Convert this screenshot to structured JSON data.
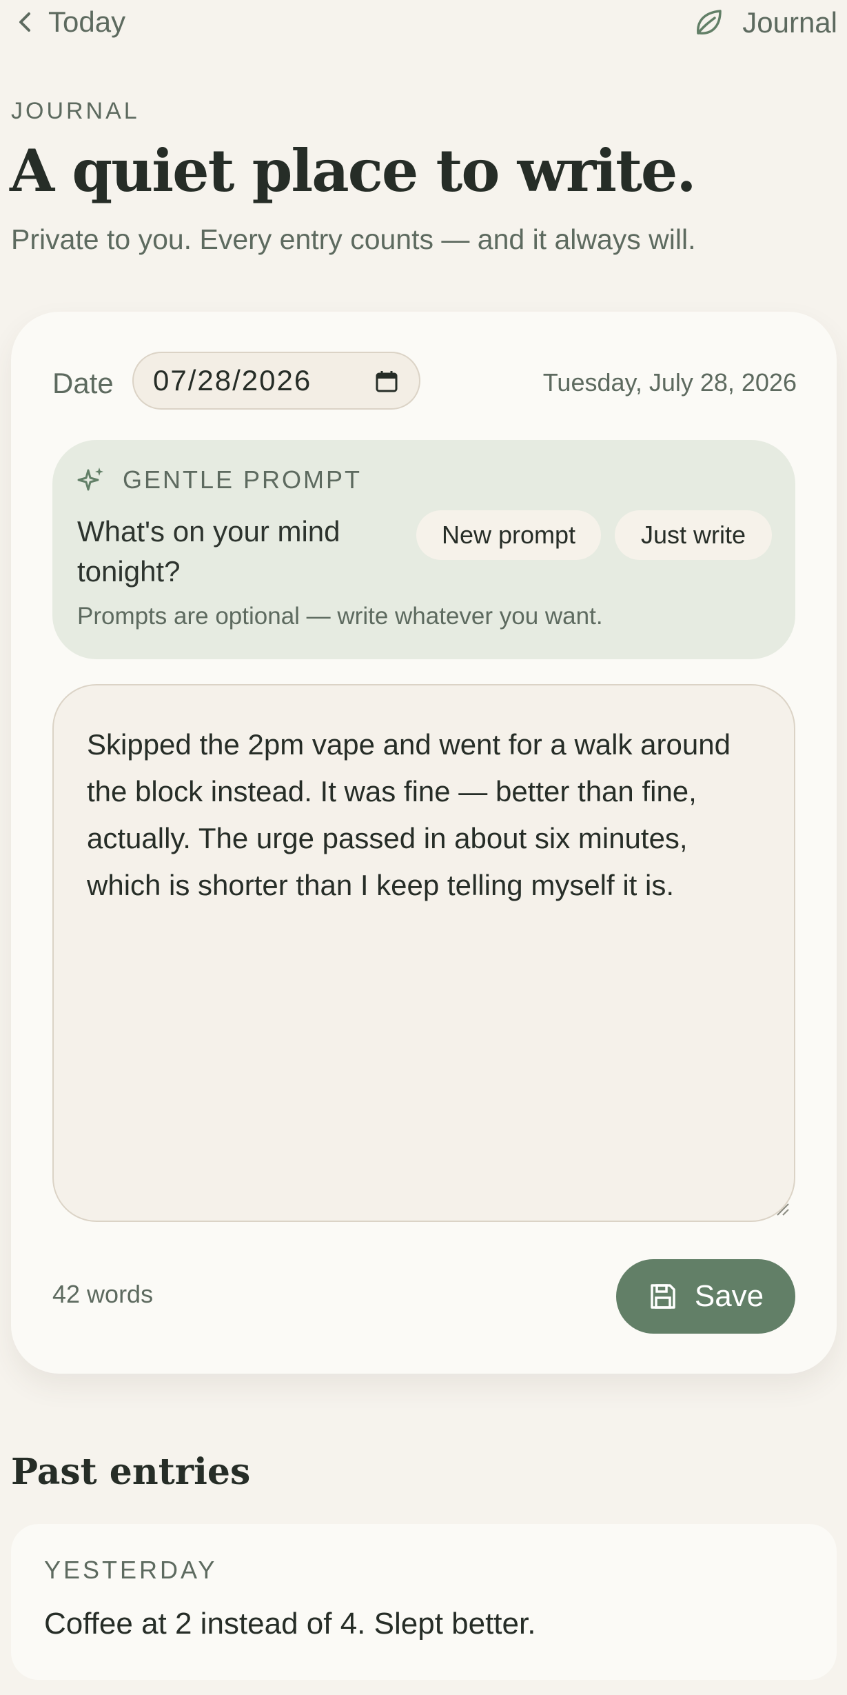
{
  "nav": {
    "back_label": "Today",
    "section_label": "Journal"
  },
  "header": {
    "eyebrow": "JOURNAL",
    "title": "A quiet place to write.",
    "subtitle": "Private to you. Every entry counts — and it always will."
  },
  "composer": {
    "date_label": "Date",
    "date_value": "07/28/2026",
    "date_full": "Tuesday, July 28, 2026",
    "prompt": {
      "heading": "GENTLE PROMPT",
      "question": "What's on your mind tonight?",
      "new_prompt_label": "New prompt",
      "just_write_label": "Just write",
      "note": "Prompts are optional — write whatever you want."
    },
    "entry_text": "Skipped the 2pm vape and went for a walk around the block instead. It was fine — better than fine, actually. The urge passed in about six minutes, which is shorter than I keep telling myself it is.",
    "word_count": "42 words",
    "save_label": "Save"
  },
  "past": {
    "title": "Past entries",
    "entries": [
      {
        "label": "YESTERDAY",
        "text": "Coffee at 2 instead of 4. Slept better."
      }
    ]
  },
  "colors": {
    "background": "#f6f3ed",
    "card": "#fbfaf6",
    "prompt_bg": "#e6ebe1",
    "accent": "#627f67",
    "text": "#262d27",
    "muted": "#5d6a5f"
  },
  "icons": {
    "back": "chevron-left-icon",
    "brand": "leaf-icon",
    "prompt": "sparkle-icon",
    "date": "calendar-icon",
    "save": "floppy-disk-icon"
  }
}
